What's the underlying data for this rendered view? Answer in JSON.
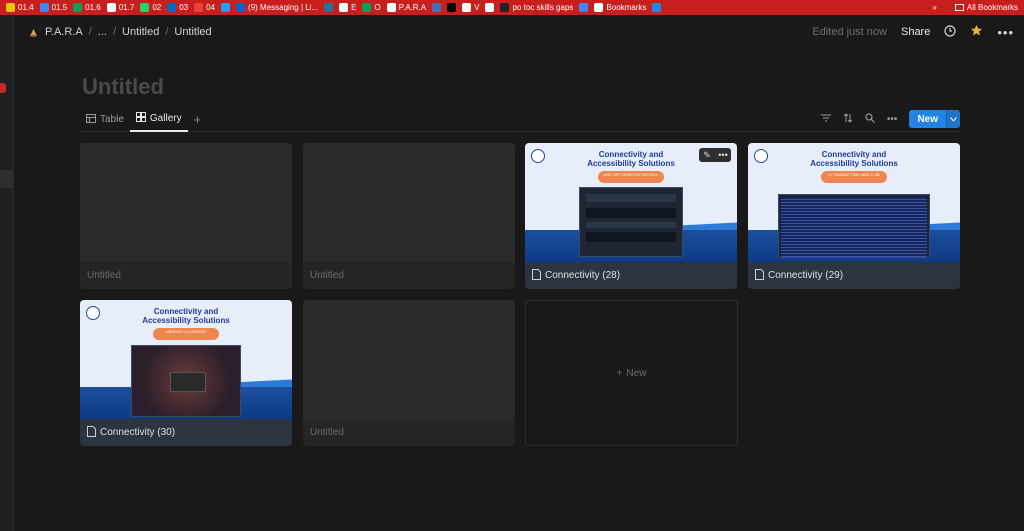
{
  "bookmarks": {
    "items": [
      {
        "label": "01.4",
        "color": "#f4c20d"
      },
      {
        "label": "01.5",
        "color": "#4285f4"
      },
      {
        "label": "01.6",
        "color": "#0f9d58"
      },
      {
        "label": "01.7",
        "color": "#ffffff"
      },
      {
        "label": "02",
        "color": "#25d366"
      },
      {
        "label": "03",
        "color": "#0a66c2"
      },
      {
        "label": "04",
        "color": "#ea4335"
      },
      {
        "label": "",
        "color": "#1da1f2"
      },
      {
        "label": "(9) Messaging | Li...",
        "color": "#0a66c2"
      },
      {
        "label": "",
        "color": "#21759b"
      },
      {
        "label": "E",
        "color": "#ffffff"
      },
      {
        "label": "O",
        "color": "#0f9d58"
      },
      {
        "label": "P.A.R.A",
        "color": "#ffffff"
      },
      {
        "label": "",
        "color": "#4b6cb7"
      },
      {
        "label": "",
        "color": "#000000"
      },
      {
        "label": "V",
        "color": "#ffffff"
      },
      {
        "label": "",
        "color": "#ffffff"
      },
      {
        "label": "po toc skills gaps",
        "color": "#222222"
      },
      {
        "label": "",
        "color": "#4285f4"
      },
      {
        "label": "Bookmarks",
        "color": "#ffffff"
      },
      {
        "label": "",
        "color": "#1e88e5"
      }
    ],
    "overflow": "»",
    "all_bookmarks": "All Bookmarks"
  },
  "topbar": {
    "workspace": "P.A.R.A",
    "ellipsis": "...",
    "crumb1": "Untitled",
    "crumb2": "Untitled",
    "edited": "Edited just now",
    "share": "Share"
  },
  "page": {
    "title": "Untitled"
  },
  "views": {
    "table": "Table",
    "gallery": "Gallery",
    "new": "New"
  },
  "cards": [
    {
      "caption": "Untitled"
    },
    {
      "caption": "Untitled"
    },
    {
      "caption": "Connectivity (28)",
      "heading": "Connectivity and Accessibility Solutions",
      "pill": "ASK GPT DESKTOP INSTALL"
    },
    {
      "caption": "Connectivity (29)",
      "heading": "Connectivity and Accessibility Solutions",
      "pill": "LI TOMASZ TIME AMD D 3B"
    },
    {
      "caption": "Connectivity (30)",
      "heading": "Connectivity and Accessibility Solutions",
      "pill": "UBUNTU L1 LOGGED"
    },
    {
      "caption": "Untitled"
    }
  ],
  "new_card": "New",
  "accent": "#2383e2"
}
